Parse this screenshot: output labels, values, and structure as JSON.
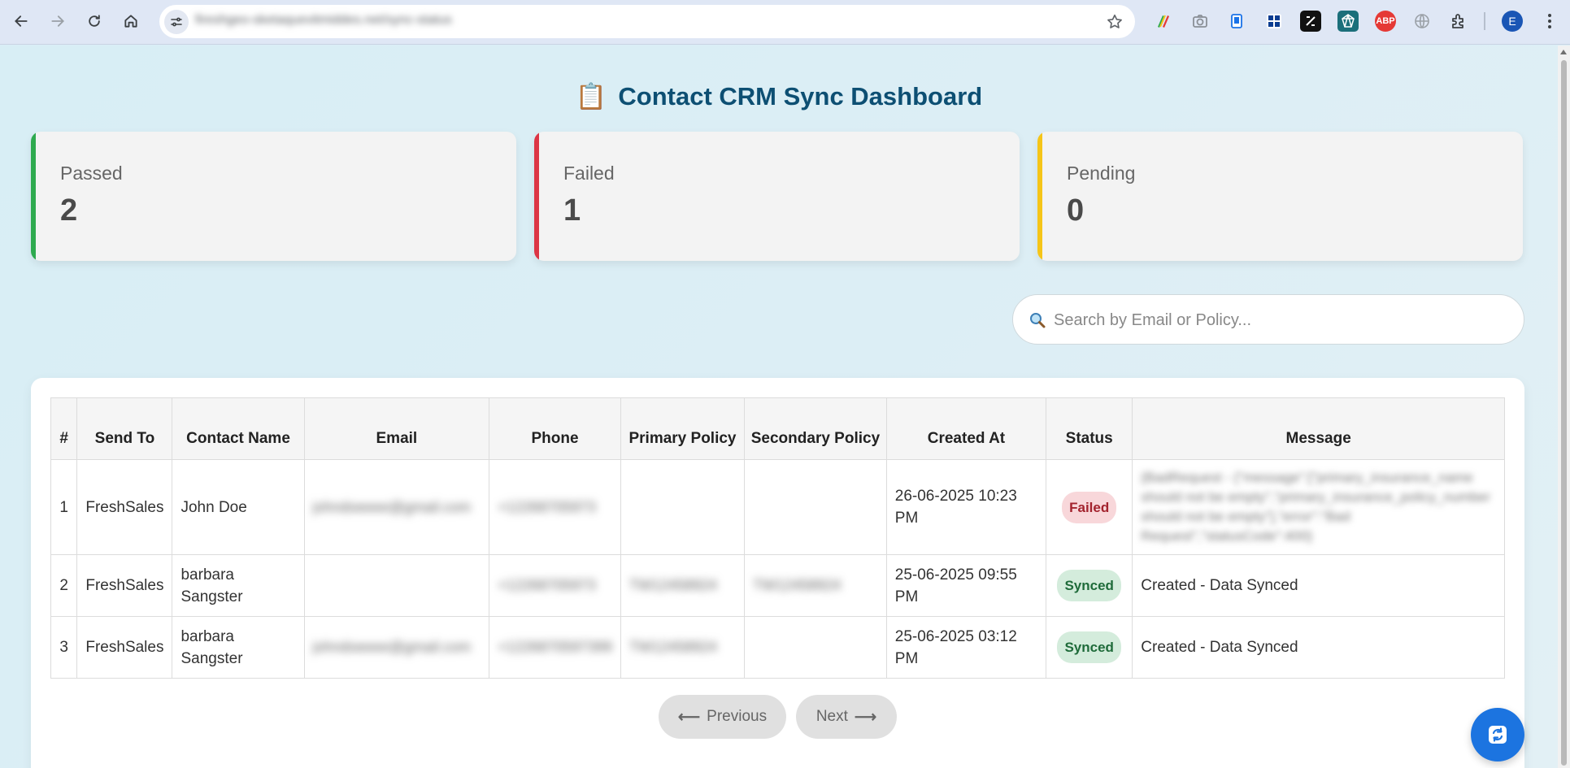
{
  "browser": {
    "url": "fireshgeo-sketaquevitmiddes.net/sync-status",
    "profile_initial": "E",
    "ext_abp_label": "ABP"
  },
  "page": {
    "title_icon": "📋",
    "title": "Contact CRM Sync Dashboard"
  },
  "stats": [
    {
      "label": "Passed",
      "value": "2",
      "color": "#2eaa4f"
    },
    {
      "label": "Failed",
      "value": "1",
      "color": "#dc3545"
    },
    {
      "label": "Pending",
      "value": "0",
      "color": "#f5c518"
    }
  ],
  "search": {
    "placeholder": "Search by Email or Policy..."
  },
  "table": {
    "headers": [
      "#",
      "Send To",
      "Contact Name",
      "Email",
      "Phone",
      "Primary Policy",
      "Secondary Policy",
      "Created At",
      "Status",
      "Message"
    ],
    "rows": [
      {
        "index": "1",
        "send_to": "FreshSales",
        "contact_name": "John Doe",
        "email": "johndoeeee@gmail.com",
        "phone": "+12268705973",
        "primary_policy": "",
        "secondary_policy": "",
        "created_at": "26-06-2025 10:23 PM",
        "status": "Failed",
        "message": "{BadRequest - {\"message\":[\"primary_insurance_name should not be empty\",\"primary_insurance_policy_number should not be empty\"],\"error\":\"Bad Request\",\"statusCode\":400}"
      },
      {
        "index": "2",
        "send_to": "FreshSales",
        "contact_name": "barbara Sangster",
        "email": "",
        "phone": "+12268705973",
        "primary_policy": "TW12458924",
        "secondary_policy": "TW12458924",
        "created_at": "25-06-2025 09:55 PM",
        "status": "Synced",
        "message": "Created - Data Synced"
      },
      {
        "index": "3",
        "send_to": "FreshSales",
        "contact_name": "barbara Sangster",
        "email": "johndoeeee@gmail.com",
        "phone": "+1226870597399",
        "primary_policy": "TW12458924",
        "secondary_policy": "",
        "created_at": "25-06-2025 03:12 PM",
        "status": "Synced",
        "message": "Created - Data Synced"
      }
    ]
  },
  "pagination": {
    "previous_label": "Previous",
    "next_label": "Next"
  }
}
